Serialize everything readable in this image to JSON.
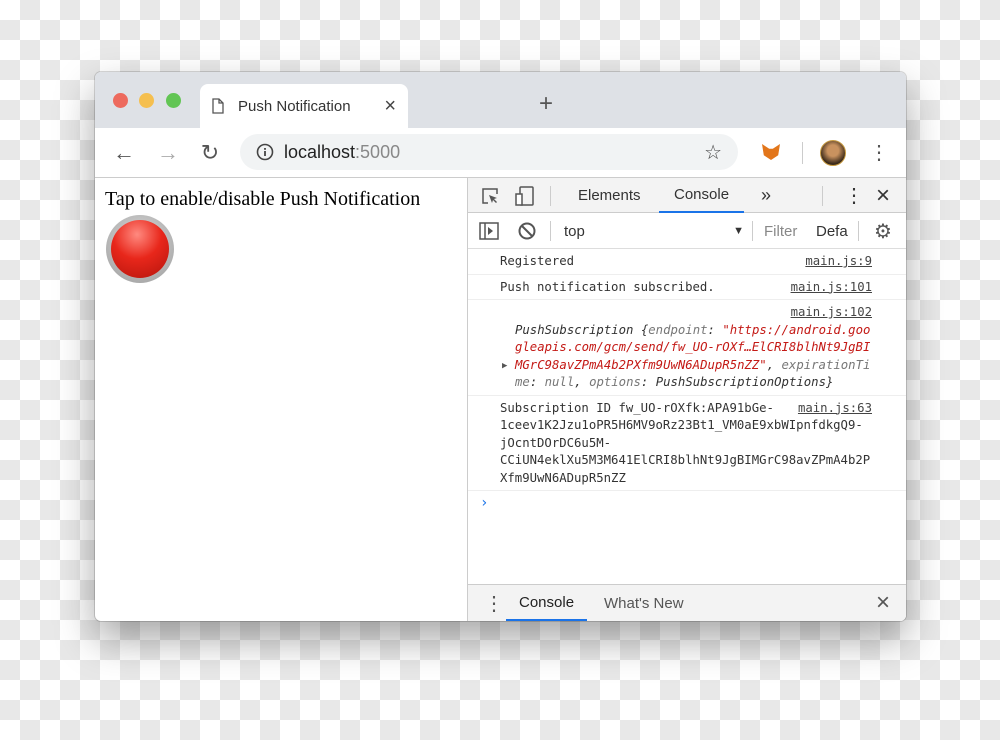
{
  "window": {
    "traffic_colors": [
      "#ed6a5e",
      "#f5bf4f",
      "#62c554"
    ]
  },
  "tab": {
    "title": "Push Notification",
    "close": "×",
    "new_tab": "+"
  },
  "toolbar": {
    "back": "←",
    "forward": "→",
    "reload": "↻",
    "host": "localhost",
    "port": ":5000",
    "star": "☆",
    "menu": "⋮"
  },
  "page": {
    "text": "Tap to enable/disable Push Notification"
  },
  "devtools": {
    "tabs": [
      {
        "label": "Elements"
      },
      {
        "label": "Console",
        "active": true
      }
    ],
    "more": "»",
    "menu": "⋮",
    "close": "×",
    "context": "top",
    "filter_placeholder": "Filter",
    "levels": "Defa",
    "messages": [
      {
        "text": "Registered",
        "source": "main.js:9"
      },
      {
        "text": "Push notification subscribed.",
        "source": "main.js:101"
      },
      {
        "source": "main.js:102",
        "obj_name": "PushSubscription",
        "open": " {",
        "k1": "endpoint",
        "sep1": ": ",
        "v1": "\"https://android.googleapis.com/gcm/send/fw_UO-rOXf…ElCRI8blhNt9JgBIMGrC98avZPmA4b2PXfm9UwN6ADupR5nZZ\"",
        "comma1": ", ",
        "k2": "expirationTime",
        "sep2": ": ",
        "v2": "null",
        "comma2": ", ",
        "k3": "options",
        "sep3": ": ",
        "v3": "PushSubscriptionOptions",
        "close": "}"
      },
      {
        "text": "Subscription ID fw_UO-rOXfk:APA91bGe-1ceev1K2Jzu1oPR5H6MV9oRz23Bt1_VM0aE9xbWIpnfdkgQ9-jOcntDOrDC6u5M-CCiUN4eklXu5M3M641ElCRI8blhNt9JgBIMGrC98avZPmA4b2PXfm9UwN6ADupR5nZZ",
        "source": "main.js:63"
      }
    ],
    "prompt": "›",
    "drawer": {
      "menu": "⋮",
      "tabs": [
        {
          "label": "Console",
          "active": true
        },
        {
          "label": "What's New"
        }
      ],
      "close": "×"
    }
  }
}
